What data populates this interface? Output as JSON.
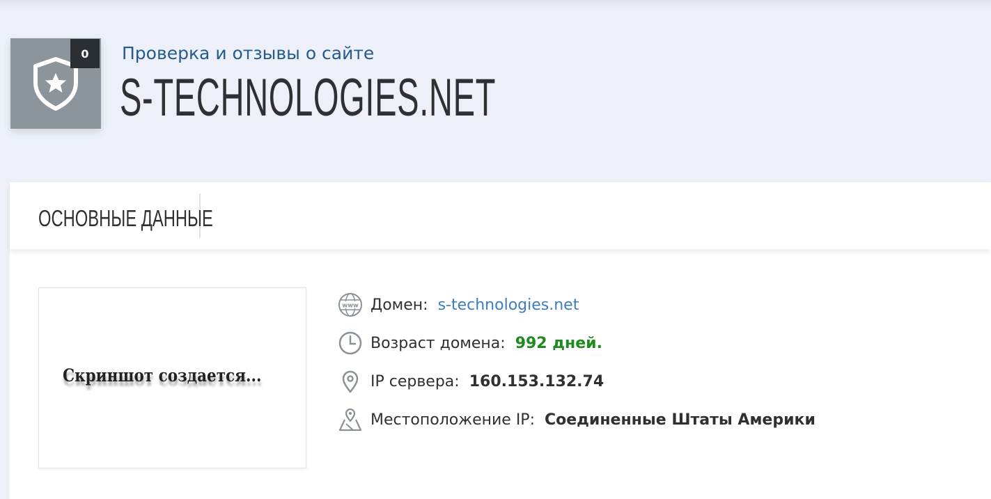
{
  "header": {
    "counter": "0",
    "subtitle": "Проверка и отзывы о сайте",
    "domain_title": "S-TECHNOLOGIES.NET"
  },
  "tabs": [
    {
      "label": "ОСНОВНЫЕ ДАННЫЕ"
    }
  ],
  "screenshot": {
    "placeholder": "Скриншот создается..."
  },
  "info": [
    {
      "icon": "www-icon",
      "label": "Домен:",
      "value": "s-technologies.net"
    },
    {
      "icon": "clock-icon",
      "label": "Возраст домена:",
      "value": "992 дней."
    },
    {
      "icon": "map-pin-icon",
      "label": "IP сервера:",
      "value": "160.153.132.74"
    },
    {
      "icon": "map-location-icon",
      "label": "Местоположение IP:",
      "value": "Соединенные Штаты Америки"
    }
  ],
  "colors": {
    "background": "#edf0f8",
    "subtitle": "#245a8e",
    "link": "#3d7dbd",
    "age": "#1f8b1f",
    "shield_box": "#8c949c"
  }
}
